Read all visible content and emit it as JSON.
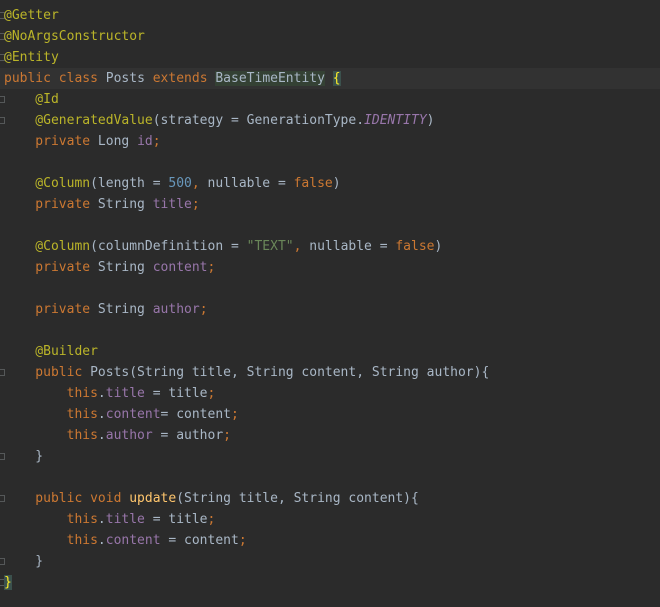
{
  "editor": {
    "lines": [
      {
        "id": "l1",
        "tokens": [
          {
            "t": "@Getter",
            "c": "ann"
          }
        ]
      },
      {
        "id": "l2",
        "tokens": [
          {
            "t": "@NoArgsConstructor",
            "c": "ann"
          }
        ]
      },
      {
        "id": "l3",
        "tokens": [
          {
            "t": "@Entity",
            "c": "ann"
          }
        ]
      },
      {
        "id": "l4",
        "tokens": [
          {
            "t": "public ",
            "c": "kw"
          },
          {
            "t": "class ",
            "c": "kw"
          },
          {
            "t": "Posts ",
            "c": "plain"
          },
          {
            "t": "extends ",
            "c": "kw"
          },
          {
            "t": "BaseTimeEntity",
            "c": "super"
          },
          {
            "t": " ",
            "c": "plain"
          },
          {
            "t": "{",
            "c": "brace-hl"
          }
        ]
      },
      {
        "id": "l5",
        "tokens": [
          {
            "t": "    @Id",
            "c": "ann"
          }
        ]
      },
      {
        "id": "l6",
        "tokens": [
          {
            "t": "    @GeneratedValue",
            "c": "ann"
          },
          {
            "t": "(strategy = GenerationType.",
            "c": "plain"
          },
          {
            "t": "IDENTITY",
            "c": "const"
          },
          {
            "t": ")",
            "c": "plain"
          }
        ]
      },
      {
        "id": "l7",
        "tokens": [
          {
            "t": "    private ",
            "c": "kw"
          },
          {
            "t": "Long ",
            "c": "plain"
          },
          {
            "t": "id",
            "c": "field"
          },
          {
            "t": ";",
            "c": "kw"
          }
        ]
      },
      {
        "id": "l8",
        "tokens": []
      },
      {
        "id": "l9",
        "tokens": [
          {
            "t": "    @Column",
            "c": "ann"
          },
          {
            "t": "(length = ",
            "c": "plain"
          },
          {
            "t": "500",
            "c": "num"
          },
          {
            "t": ", ",
            "c": "kw"
          },
          {
            "t": "nullable = ",
            "c": "plain"
          },
          {
            "t": "false",
            "c": "kw"
          },
          {
            "t": ")",
            "c": "plain"
          }
        ]
      },
      {
        "id": "l10",
        "tokens": [
          {
            "t": "    private ",
            "c": "kw"
          },
          {
            "t": "String ",
            "c": "plain"
          },
          {
            "t": "title",
            "c": "field"
          },
          {
            "t": ";",
            "c": "kw"
          }
        ]
      },
      {
        "id": "l11",
        "tokens": []
      },
      {
        "id": "l12",
        "tokens": [
          {
            "t": "    @Column",
            "c": "ann"
          },
          {
            "t": "(columnDefinition = ",
            "c": "plain"
          },
          {
            "t": "\"TEXT\"",
            "c": "str"
          },
          {
            "t": ", ",
            "c": "kw"
          },
          {
            "t": "nullable = ",
            "c": "plain"
          },
          {
            "t": "false",
            "c": "kw"
          },
          {
            "t": ")",
            "c": "plain"
          }
        ]
      },
      {
        "id": "l13",
        "tokens": [
          {
            "t": "    private ",
            "c": "kw"
          },
          {
            "t": "String ",
            "c": "plain"
          },
          {
            "t": "content",
            "c": "field"
          },
          {
            "t": ";",
            "c": "kw"
          }
        ]
      },
      {
        "id": "l14",
        "tokens": []
      },
      {
        "id": "l15",
        "tokens": [
          {
            "t": "    private ",
            "c": "kw"
          },
          {
            "t": "String ",
            "c": "plain"
          },
          {
            "t": "author",
            "c": "field"
          },
          {
            "t": ";",
            "c": "kw"
          }
        ]
      },
      {
        "id": "l16",
        "tokens": []
      },
      {
        "id": "l17",
        "tokens": [
          {
            "t": "    @Builder",
            "c": "ann"
          }
        ]
      },
      {
        "id": "l18",
        "tokens": [
          {
            "t": "    public ",
            "c": "kw"
          },
          {
            "t": "Posts",
            "c": "ctor"
          },
          {
            "t": "(String title, ",
            "c": "plain"
          },
          {
            "t": "String content, ",
            "c": "plain"
          },
          {
            "t": "String author){",
            "c": "plain"
          }
        ]
      },
      {
        "id": "l19",
        "tokens": [
          {
            "t": "        this",
            "c": "kw"
          },
          {
            "t": ".",
            "c": "plain"
          },
          {
            "t": "title",
            "c": "field"
          },
          {
            "t": " = title",
            "c": "plain"
          },
          {
            "t": ";",
            "c": "kw"
          }
        ]
      },
      {
        "id": "l20",
        "tokens": [
          {
            "t": "        this",
            "c": "kw"
          },
          {
            "t": ".",
            "c": "plain"
          },
          {
            "t": "content",
            "c": "field"
          },
          {
            "t": "= content",
            "c": "plain"
          },
          {
            "t": ";",
            "c": "kw"
          }
        ]
      },
      {
        "id": "l21",
        "tokens": [
          {
            "t": "        this",
            "c": "kw"
          },
          {
            "t": ".",
            "c": "plain"
          },
          {
            "t": "author",
            "c": "field"
          },
          {
            "t": " = author",
            "c": "plain"
          },
          {
            "t": ";",
            "c": "kw"
          }
        ]
      },
      {
        "id": "l22",
        "tokens": [
          {
            "t": "    }",
            "c": "plain"
          }
        ]
      },
      {
        "id": "l23",
        "tokens": []
      },
      {
        "id": "l24",
        "tokens": [
          {
            "t": "    public ",
            "c": "kw"
          },
          {
            "t": "void ",
            "c": "kw"
          },
          {
            "t": "update",
            "c": "fn"
          },
          {
            "t": "(String title, ",
            "c": "plain"
          },
          {
            "t": "String content){",
            "c": "plain"
          }
        ]
      },
      {
        "id": "l25",
        "tokens": [
          {
            "t": "        this",
            "c": "kw"
          },
          {
            "t": ".",
            "c": "plain"
          },
          {
            "t": "title",
            "c": "field"
          },
          {
            "t": " = title",
            "c": "plain"
          },
          {
            "t": ";",
            "c": "kw"
          }
        ]
      },
      {
        "id": "l26",
        "tokens": [
          {
            "t": "        this",
            "c": "kw"
          },
          {
            "t": ".",
            "c": "plain"
          },
          {
            "t": "content",
            "c": "field"
          },
          {
            "t": " = content",
            "c": "plain"
          },
          {
            "t": ";",
            "c": "kw"
          }
        ]
      },
      {
        "id": "l27",
        "tokens": [
          {
            "t": "    }",
            "c": "plain"
          }
        ]
      },
      {
        "id": "l28",
        "tokens": [
          {
            "t": "}",
            "c": "brace-hl"
          }
        ]
      }
    ],
    "current_line": 4,
    "fold_lines": [
      1,
      2,
      3,
      5,
      6,
      18,
      22,
      24,
      27,
      28
    ]
  },
  "colors": {
    "background": "#2b2b2b",
    "current_line": "#323232",
    "keyword": "#cc7832",
    "annotation": "#bbb529",
    "field": "#9876aa",
    "number": "#6897bb",
    "string": "#6a8759",
    "function": "#ffc66d",
    "text": "#a9b7c6",
    "brace_highlight": "#ffef28"
  }
}
